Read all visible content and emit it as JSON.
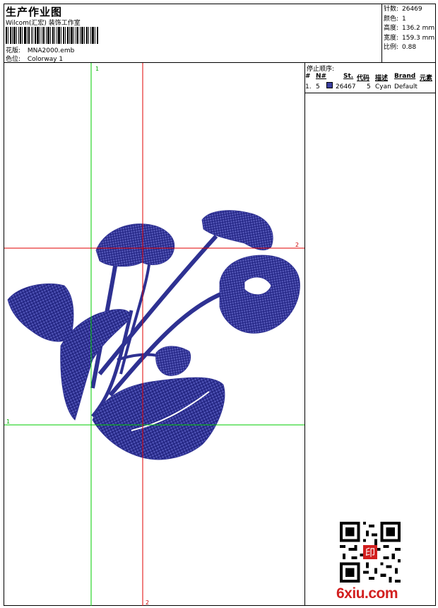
{
  "header": {
    "title": "生产作业图",
    "company": "Wilcom(汇宏) 装饰工作室",
    "design_label": "花版:",
    "design_value": "MNA2000.emb",
    "colorway_label": "色位:",
    "colorway_value": "Colorway 1"
  },
  "stats": {
    "stitches_label": "针数:",
    "stitches_value": "26469",
    "colors_label": "颜色:",
    "colors_value": "1",
    "height_label": "高度:",
    "height_value": "136.2 mm",
    "width_label": "宽度:",
    "width_value": "159.3 mm",
    "scale_label": "比例:",
    "scale_value": "0.88"
  },
  "stop_sequence": {
    "title": "停止顺序:",
    "columns": [
      "#",
      "N#",
      "St.",
      "代码",
      "描述",
      "Brand",
      "元素"
    ],
    "rows": [
      {
        "index": "1.",
        "needle": "5",
        "swatch_color": "#3b3fa0",
        "stitches": "26467",
        "code": "5",
        "description": "Cyan",
        "brand": "Default",
        "element": ""
      }
    ]
  },
  "guides": {
    "v1_label": "1",
    "v2_label": "2",
    "v2_bottom_label": "2",
    "h1_label": "1",
    "h2_label": "2",
    "green": "#00cc00",
    "red": "#e00000"
  },
  "embroidery_color": "#2e3192",
  "logo": {
    "text": "6xiu.com",
    "color": "#d21f1f"
  },
  "qr_stamp": {
    "text": "印"
  }
}
